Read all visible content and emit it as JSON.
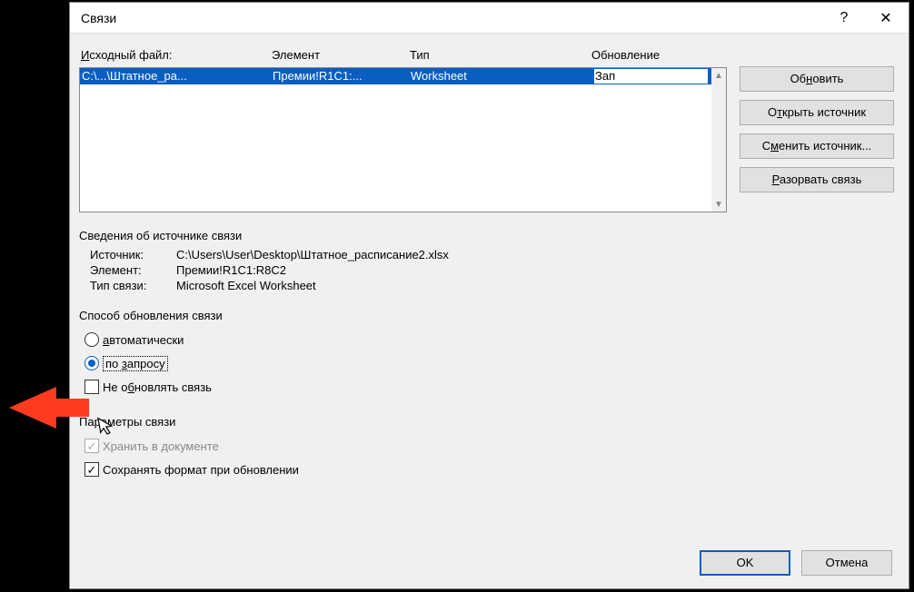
{
  "title": "Связи",
  "columns": {
    "src": "Исходный файл:",
    "elem": "Элемент",
    "type": "Тип",
    "upd": "Обновление"
  },
  "rows": [
    {
      "src": "C:\\...\\Штатное_ра...",
      "elem": "Премии!R1C1:...",
      "type": "Worksheet",
      "upd": "Зап"
    }
  ],
  "buttons": {
    "update": "Обновить",
    "open_source": "Открыть источник",
    "change_source": "Сменить источник...",
    "break_link": "Разорвать связь"
  },
  "info_section_title": "Сведения об источнике связи",
  "info": {
    "source_label": "Источник:",
    "source_value": "C:\\Users\\User\\Desktop\\Штатное_расписание2.xlsx",
    "element_label": "Элемент:",
    "element_value": "Премии!R1C1:R8C2",
    "type_label": "Тип связи:",
    "type_value": "Microsoft Excel Worksheet"
  },
  "update_section_title": "Способ обновления связи",
  "update_options": {
    "auto": "автоматически",
    "on_request": "по запросу",
    "no_update": "Не обновлять связь"
  },
  "params_section_title": "Параметры связи",
  "params": {
    "store_in_doc": "Хранить в документе",
    "preserve_format": "Сохранять формат при обновлении"
  },
  "footer": {
    "ok": "OK",
    "cancel": "Отмена"
  }
}
